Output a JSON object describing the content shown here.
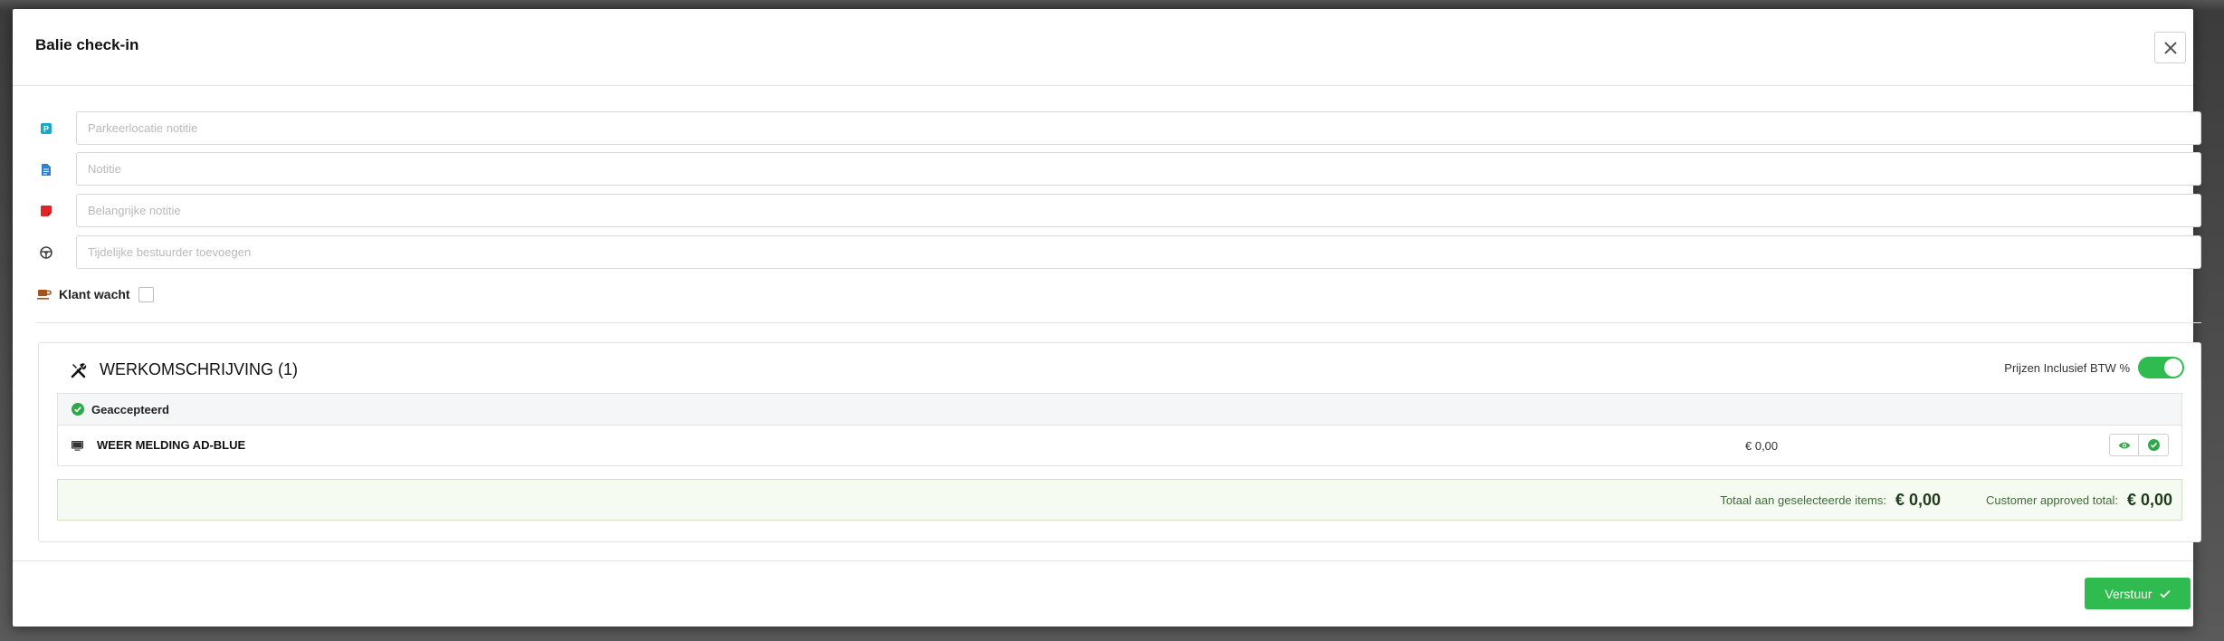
{
  "modal": {
    "title": "Balie check-in",
    "close_icon": "close-icon"
  },
  "fields": {
    "parking": {
      "placeholder": "Parkeerlocatie notitie",
      "icon": "parking-icon",
      "icon_color": "#1aa7c8"
    },
    "note": {
      "placeholder": "Notitie",
      "icon": "document-icon",
      "icon_color": "#2e7fd0"
    },
    "important": {
      "placeholder": "Belangrijke notitie",
      "icon": "sticky-note-icon",
      "icon_color": "#e02424"
    },
    "driver": {
      "placeholder": "Tijdelijke bestuurder toevoegen",
      "icon": "steering-wheel-icon",
      "icon_color": "#444444"
    }
  },
  "customer_waiting": {
    "label": "Klant wacht",
    "checked": false,
    "icon": "coffee-cup-icon",
    "icon_color": "#a5541a"
  },
  "work": {
    "title": "WERKOMSCHRIJVING (1)",
    "icon": "tools-icon",
    "vat_toggle": {
      "label": "Prijzen Inclusief BTW %",
      "on": true
    },
    "groups": [
      {
        "status": "Geaccepteerd",
        "status_icon": "check-circle-icon",
        "items": [
          {
            "name": "WEER MELDING AD-BLUE",
            "icon": "monitor-icon",
            "price": "€ 0,00",
            "actions": [
              "eye-icon",
              "check-circle-icon"
            ]
          }
        ]
      }
    ],
    "totals": {
      "selected_label": "Totaal aan geselecteerde items:",
      "selected_value": "€ 0,00",
      "approved_label": "Customer approved total:",
      "approved_value": "€ 0,00"
    }
  },
  "footer": {
    "submit_label": "Verstuur",
    "submit_icon": "check-icon"
  },
  "colors": {
    "accent_green": "#2fbb4f",
    "totals_bg": "#f5fbf1"
  }
}
